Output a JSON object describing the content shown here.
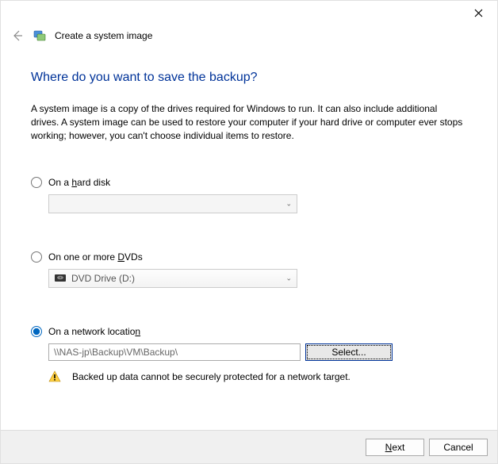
{
  "window": {
    "title": "Create a system image"
  },
  "heading": "Where do you want to save the backup?",
  "description": "A system image is a copy of the drives required for Windows to run. It can also include additional drives. A system image can be used to restore your computer if your hard drive or computer ever stops working; however, you can't choose individual items to restore.",
  "options": {
    "hard_disk": {
      "label_pre": "On a ",
      "label_ul": "h",
      "label_post": "ard disk"
    },
    "dvd": {
      "label_pre": "On one or more ",
      "label_ul": "D",
      "label_post": "VDs",
      "selected": "DVD Drive (D:)"
    },
    "network": {
      "label_pre": "On a network locatio",
      "label_ul": "n",
      "label_post": "",
      "path": "\\\\NAS-jp\\Backup\\VM\\Backup\\",
      "select_btn": "Select...",
      "warning": "Backed up data cannot be securely protected for a network target."
    }
  },
  "footer": {
    "next_ul": "N",
    "next_rest": "ext",
    "cancel": "Cancel"
  }
}
